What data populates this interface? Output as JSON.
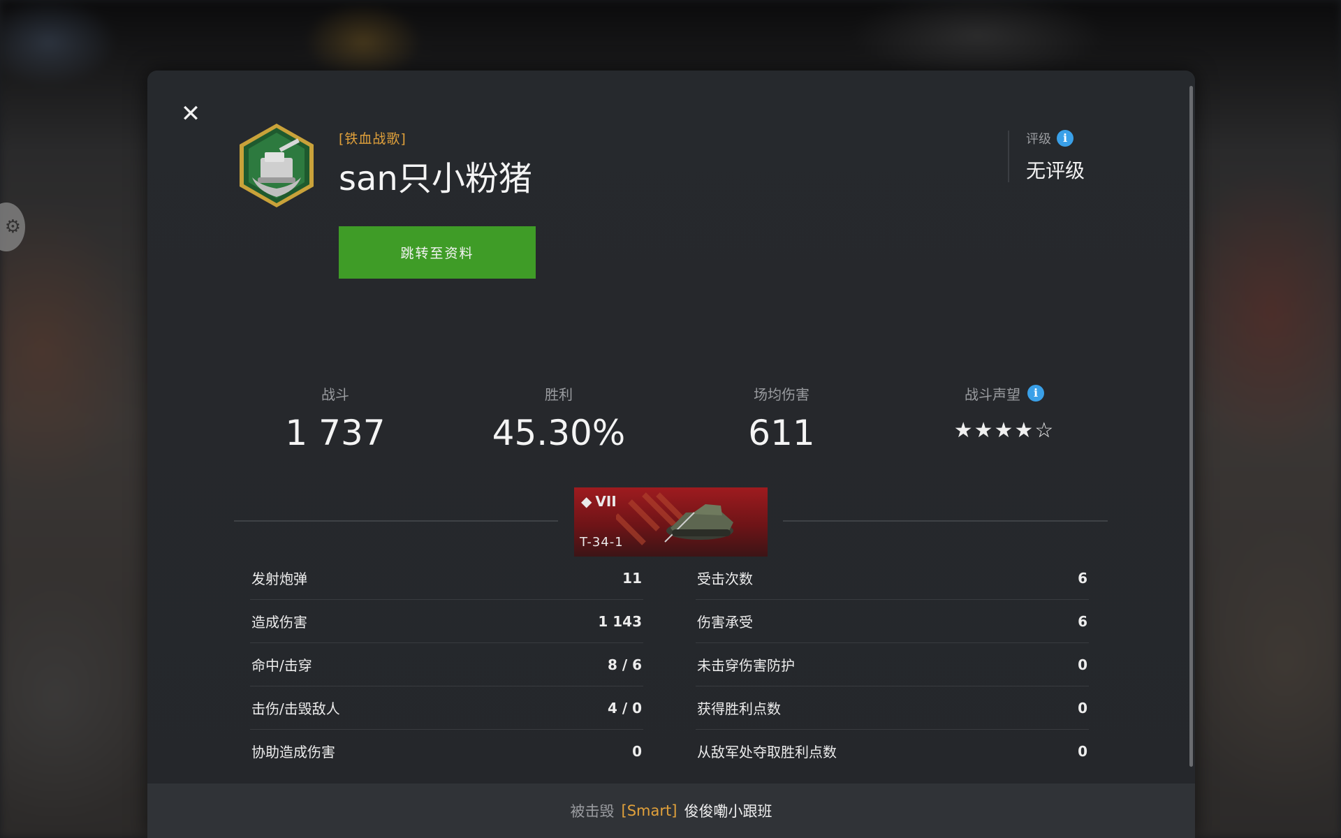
{
  "player": {
    "clan_tag": "[铁血战歌]",
    "name": "san只小粉猪",
    "profile_button": "跳转至资料"
  },
  "rating": {
    "label": "评级",
    "value": "无评级"
  },
  "stats": {
    "battles_label": "战斗",
    "battles_value": "1 737",
    "wins_label": "胜利",
    "wins_value": "45.30%",
    "avg_damage_label": "场均伤害",
    "avg_damage_value": "611",
    "reputation_label": "战斗声望",
    "reputation_stars": "★★★★☆",
    "reputation_level": 4
  },
  "tank": {
    "tier": "VII",
    "name": "T-34-1"
  },
  "left_table": [
    {
      "label": "发射炮弹",
      "value": "11"
    },
    {
      "label": "造成伤害",
      "value": "1 143"
    },
    {
      "label": "命中/击穿",
      "value": "8 / 6"
    },
    {
      "label": "击伤/击毁敌人",
      "value": "4 / 0"
    },
    {
      "label": "协助造成伤害",
      "value": "0"
    }
  ],
  "right_table": [
    {
      "label": "受击次数",
      "value": "6"
    },
    {
      "label": "伤害承受",
      "value": "6"
    },
    {
      "label": "未击穿伤害防护",
      "value": "0"
    },
    {
      "label": "获得胜利点数",
      "value": "0"
    },
    {
      "label": "从敌军处夺取胜利点数",
      "value": "0"
    }
  ],
  "footer": {
    "prefix": "被击毁",
    "killer_tag": "[Smart]",
    "killer_name": "俊俊嘞小跟班"
  },
  "icons": {
    "close": "close-icon",
    "info": "info-icon",
    "emblem": "achievement-emblem-icon",
    "tier": "tank-type-icon"
  },
  "colors": {
    "accent_green": "#3f9c27",
    "clan_orange": "#e1a13b",
    "info_blue": "#3aa0e8",
    "tank_red": "#9e1b1f"
  }
}
